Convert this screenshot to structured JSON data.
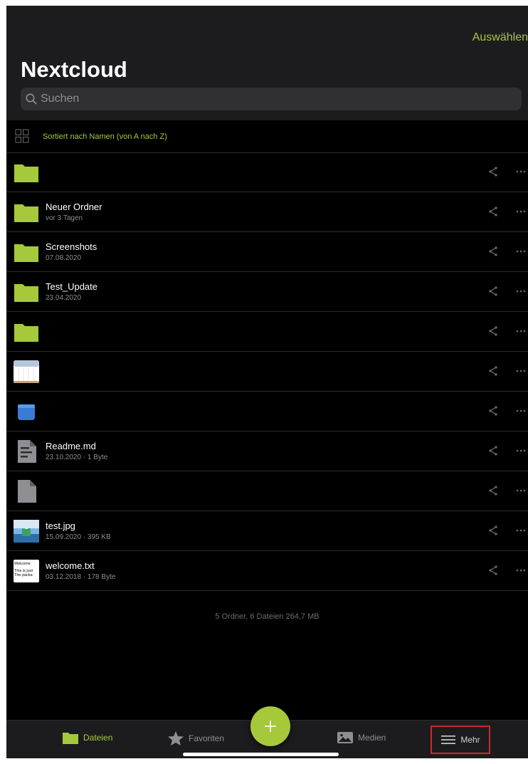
{
  "header": {
    "select_label": "Auswählen",
    "title": "Nextcloud",
    "search_placeholder": "Suchen"
  },
  "sort_bar": {
    "label": "Sortiert nach Namen (von A nach Z)"
  },
  "files": [
    {
      "type": "folder",
      "name": "",
      "info": ""
    },
    {
      "type": "folder",
      "name": "Neuer Ordner",
      "info": "vor 3 Tagen"
    },
    {
      "type": "folder",
      "name": "Screenshots",
      "info": "07.08.2020"
    },
    {
      "type": "folder",
      "name": "Test_Update",
      "info": "23.04.2020"
    },
    {
      "type": "folder",
      "name": "",
      "info": ""
    },
    {
      "type": "image-thumb-sheet",
      "name": "",
      "info": ""
    },
    {
      "type": "blue-file",
      "name": "",
      "info": ""
    },
    {
      "type": "document",
      "name": "Readme.md",
      "info": "23.10.2020 · 1 Byte"
    },
    {
      "type": "blank-file",
      "name": "",
      "info": ""
    },
    {
      "type": "image-thumb",
      "name": "test.jpg",
      "info": "15.09.2020 · 395 KB"
    },
    {
      "type": "text-thumb",
      "name": "welcome.txt",
      "info": "03.12.2018 · 178 Byte",
      "thumb_lines": [
        "Welcome",
        "This is just",
        "The packa"
      ]
    }
  ],
  "summary": "5 Ordner, 6 Dateien 264,7 MB",
  "tabbar": {
    "dateien": "Dateien",
    "favoriten": "Favoriten",
    "medien": "Medien",
    "mehr": "Mehr"
  },
  "colors": {
    "accent": "#a5c93a",
    "highlight_box": "#d0282c"
  },
  "icons": [
    "search-icon",
    "grid-view-icon",
    "folder-icon",
    "share-icon",
    "more-icon",
    "document-icon",
    "star-icon",
    "photo-icon",
    "menu-icon",
    "plus-icon"
  ]
}
